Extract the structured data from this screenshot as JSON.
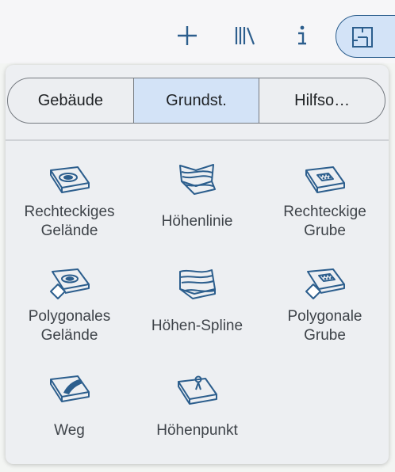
{
  "toolbar": {
    "icons": [
      "plus-icon",
      "library-icon",
      "info-icon",
      "floor-plan-icon"
    ],
    "accent_color": "#2c5e8d",
    "active_bg": "#d3e3f7"
  },
  "tabs": [
    {
      "label": "Gebäude",
      "active": false
    },
    {
      "label": "Grundst.",
      "active": true
    },
    {
      "label": "Hilfso…",
      "active": false
    }
  ],
  "tools": [
    {
      "label": "Rechteckiges\nGelände",
      "icon": "rect-terrain-icon"
    },
    {
      "label": "Höhenlinie",
      "icon": "contour-line-icon"
    },
    {
      "label": "Rechteckige\nGrube",
      "icon": "rect-pit-icon"
    },
    {
      "label": "Polygonales\nGelände",
      "icon": "polygon-terrain-icon"
    },
    {
      "label": "Höhen-Spline",
      "icon": "elevation-spline-icon"
    },
    {
      "label": "Polygonale\nGrube",
      "icon": "polygon-pit-icon"
    },
    {
      "label": "Weg",
      "icon": "path-icon"
    },
    {
      "label": "Höhenpunkt",
      "icon": "elevation-point-icon"
    }
  ]
}
